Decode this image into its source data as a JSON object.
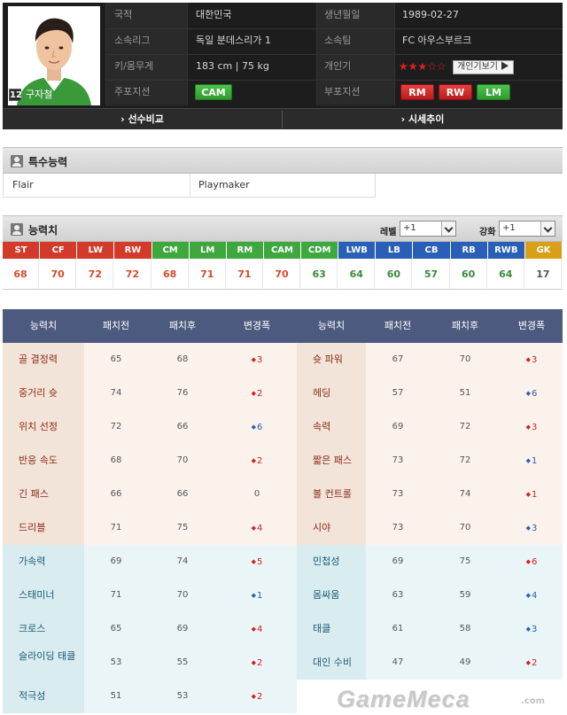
{
  "player": {
    "jersey": "12",
    "name": "구자철",
    "info": [
      {
        "label": "국적",
        "value": "대한민국"
      },
      {
        "label": "생년월일",
        "value": "1989-02-27"
      },
      {
        "label": "소속리그",
        "value": "독일 분데스리가 1"
      },
      {
        "label": "소속팀",
        "value": "FC 아우스부르크"
      },
      {
        "label": "키/몸무게",
        "value": "183 cm  |  75 kg"
      },
      {
        "label": "개인기",
        "value": "★★★☆☆"
      },
      {
        "label": "주포지션",
        "value": ""
      },
      {
        "label": "부포지션",
        "value": ""
      }
    ],
    "skill_stars": 3,
    "skill_stars_max": 5,
    "personal_skill_button": "개인기보기 ▶",
    "main_position": "CAM",
    "sub_positions": [
      "RM",
      "RW",
      "LM"
    ]
  },
  "card_tabs": [
    {
      "label": "› 선수비교"
    },
    {
      "label": "› 시세추이"
    }
  ],
  "special": {
    "title": "특수능력",
    "items": [
      "Flair",
      "Playmaker"
    ]
  },
  "ability": {
    "title": "능력치",
    "level_label": "레벨",
    "level_value": "+1",
    "enhance_label": "강화",
    "enhance_value": "+1",
    "positions": [
      {
        "pos": "ST",
        "value": "68",
        "color": "#d23a2a",
        "val_color": "#d84a2a"
      },
      {
        "pos": "CF",
        "value": "70",
        "color": "#d23a2a",
        "val_color": "#d84a2a"
      },
      {
        "pos": "LW",
        "value": "72",
        "color": "#d23a2a",
        "val_color": "#d84a2a"
      },
      {
        "pos": "RW",
        "value": "72",
        "color": "#d23a2a",
        "val_color": "#d84a2a"
      },
      {
        "pos": "CM",
        "value": "68",
        "color": "#3ea83e",
        "val_color": "#d84a2a"
      },
      {
        "pos": "LM",
        "value": "71",
        "color": "#3ea83e",
        "val_color": "#d84a2a"
      },
      {
        "pos": "RM",
        "value": "71",
        "color": "#3ea83e",
        "val_color": "#d84a2a"
      },
      {
        "pos": "CAM",
        "value": "70",
        "color": "#3ea83e",
        "val_color": "#d84a2a"
      },
      {
        "pos": "CDM",
        "value": "63",
        "color": "#3ea83e",
        "val_color": "#3a8a3a"
      },
      {
        "pos": "LWB",
        "value": "64",
        "color": "#2a5fb8",
        "val_color": "#3a8a3a"
      },
      {
        "pos": "LB",
        "value": "60",
        "color": "#2a5fb8",
        "val_color": "#3a8a3a"
      },
      {
        "pos": "CB",
        "value": "57",
        "color": "#2a5fb8",
        "val_color": "#3a8a3a"
      },
      {
        "pos": "RB",
        "value": "60",
        "color": "#2a5fb8",
        "val_color": "#3a8a3a"
      },
      {
        "pos": "RWB",
        "value": "64",
        "color": "#2a5fb8",
        "val_color": "#3a8a3a"
      },
      {
        "pos": "GK",
        "value": "17",
        "color": "#d8a018",
        "val_color": "#555555"
      }
    ]
  },
  "stat_table": {
    "headers": [
      "능력치",
      "패치전",
      "패치후",
      "변경폭",
      "능력치",
      "패치전",
      "패치후",
      "변경폭"
    ],
    "rows": [
      {
        "l": {
          "name": "골 결정력",
          "before": "65",
          "after": "68",
          "delta": "3",
          "dir": "up"
        },
        "r": {
          "name": "슛 파워",
          "before": "67",
          "after": "70",
          "delta": "3",
          "dir": "up"
        },
        "tone": "warm"
      },
      {
        "l": {
          "name": "중거리 슛",
          "before": "74",
          "after": "76",
          "delta": "2",
          "dir": "up"
        },
        "r": {
          "name": "헤딩",
          "before": "57",
          "after": "51",
          "delta": "6",
          "dir": "down"
        },
        "tone": "warm"
      },
      {
        "l": {
          "name": "위치 선정",
          "before": "72",
          "after": "66",
          "delta": "6",
          "dir": "down"
        },
        "r": {
          "name": "속력",
          "before": "69",
          "after": "72",
          "delta": "3",
          "dir": "up"
        },
        "tone": "warm"
      },
      {
        "l": {
          "name": "반응 속도",
          "before": "68",
          "after": "70",
          "delta": "2",
          "dir": "up"
        },
        "r": {
          "name": "짧은 패스",
          "before": "73",
          "after": "72",
          "delta": "1",
          "dir": "down"
        },
        "tone": "warm"
      },
      {
        "l": {
          "name": "긴 패스",
          "before": "66",
          "after": "66",
          "delta": "0",
          "dir": "zero"
        },
        "r": {
          "name": "볼 컨트롤",
          "before": "73",
          "after": "74",
          "delta": "1",
          "dir": "up"
        },
        "tone": "warm"
      },
      {
        "l": {
          "name": "드리블",
          "before": "71",
          "after": "75",
          "delta": "4",
          "dir": "up"
        },
        "r": {
          "name": "시야",
          "before": "73",
          "after": "70",
          "delta": "3",
          "dir": "down"
        },
        "tone": "warm"
      },
      {
        "l": {
          "name": "가속력",
          "before": "69",
          "after": "74",
          "delta": "5",
          "dir": "up"
        },
        "r": {
          "name": "민첩성",
          "before": "69",
          "after": "75",
          "delta": "6",
          "dir": "up"
        },
        "tone": "cool"
      },
      {
        "l": {
          "name": "스태미너",
          "before": "71",
          "after": "70",
          "delta": "1",
          "dir": "down"
        },
        "r": {
          "name": "몸싸움",
          "before": "63",
          "after": "59",
          "delta": "4",
          "dir": "down"
        },
        "tone": "cool"
      },
      {
        "l": {
          "name": "크로스",
          "before": "65",
          "after": "69",
          "delta": "4",
          "dir": "up"
        },
        "r": {
          "name": "태클",
          "before": "61",
          "after": "58",
          "delta": "3",
          "dir": "down"
        },
        "tone": "cool"
      },
      {
        "l": {
          "name": "슬라이딩 태클",
          "before": "53",
          "after": "55",
          "delta": "2",
          "dir": "up"
        },
        "r": {
          "name": "대인 수비",
          "before": "47",
          "after": "49",
          "delta": "2",
          "dir": "up"
        },
        "tone": "cool"
      },
      {
        "l": {
          "name": "적극성",
          "before": "51",
          "after": "53",
          "delta": "2",
          "dir": "up"
        },
        "r": null,
        "tone": "cool"
      }
    ]
  },
  "watermark": {
    "text": "GameMeca",
    "suffix": ".com"
  },
  "colors": {
    "card_bg": "#1d1d1d",
    "table_header": "#4b5a7e",
    "warm_name": "#f3e4da",
    "warm_row": "#fbf2ec",
    "cool_name": "#d9edf1",
    "cool_row": "#eaf5f7",
    "up": "#d02020",
    "down": "#2a5fb0"
  }
}
